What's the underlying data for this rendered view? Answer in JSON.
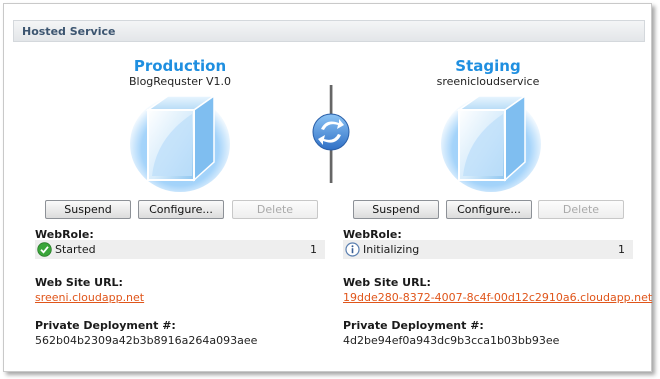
{
  "section": {
    "title": "Hosted Service"
  },
  "production": {
    "name": "Production",
    "subtitle": "BlogRequster V1.0",
    "buttons": {
      "suspend": "Suspend",
      "configure": "Configure...",
      "delete": "Delete"
    },
    "role_label": "WebRole:",
    "role_status": "Started",
    "role_count": "1",
    "url_label": "Web Site URL:",
    "url": "sreeni.cloudapp.net",
    "deployment_label": "Private Deployment #:",
    "deployment_id": "562b04b2309a42b3b8916a264a093aee"
  },
  "staging": {
    "name": "Staging",
    "subtitle": "sreenicloudservice",
    "buttons": {
      "suspend": "Suspend",
      "configure": "Configure...",
      "delete": "Delete"
    },
    "role_label": "WebRole:",
    "role_status": "Initializing",
    "role_count": "1",
    "url_label": "Web Site URL:",
    "url": "19dde280-8372-4007-8c4f-00d12c2910a6.cloudapp.net",
    "deployment_label": "Private Deployment #:",
    "deployment_id": "4d2be94ef0a943dc9b3cca1b03bb93ee"
  },
  "icons": {
    "cube": "cloud-cube-icon",
    "swap": "swap-vip-icon",
    "started": "check-circle-icon",
    "initializing": "info-circle-icon"
  },
  "colors": {
    "env_title": "#1f8fe0",
    "link": "#e0551a",
    "header_text": "#3c5570",
    "started": "#3aa53a",
    "swap": "#3a7fd0"
  }
}
